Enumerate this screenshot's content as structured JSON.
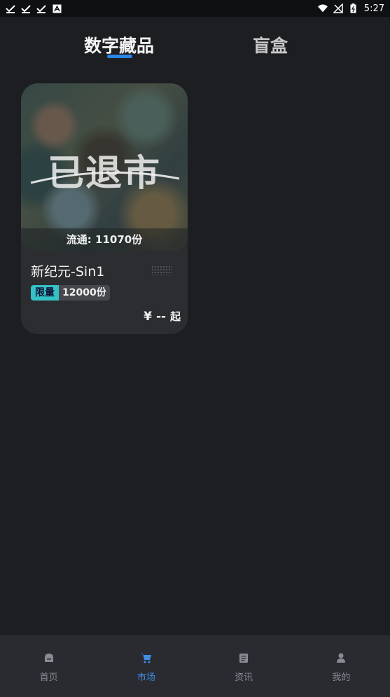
{
  "status_bar": {
    "time": "5:27"
  },
  "tabs": [
    {
      "label": "数字藏品",
      "active": true
    },
    {
      "label": "盲盒",
      "active": false
    }
  ],
  "card": {
    "overlay_text": "已退市",
    "circulation": "流通:  11070份",
    "name": "新纪元-Sin1",
    "badge_limited": "限量",
    "badge_count": "12000份",
    "price_symbol": "¥",
    "price_value": "--",
    "price_suffix": "起"
  },
  "bottom_nav": [
    {
      "label": "首页",
      "icon": "home-icon",
      "active": false
    },
    {
      "label": "市场",
      "icon": "cart-icon",
      "active": true
    },
    {
      "label": "资讯",
      "icon": "news-icon",
      "active": false
    },
    {
      "label": "我的",
      "icon": "profile-icon",
      "active": false
    }
  ],
  "colors": {
    "accent": "#2a86e4",
    "badge": "#35c2c6",
    "background": "#1d1e22"
  }
}
